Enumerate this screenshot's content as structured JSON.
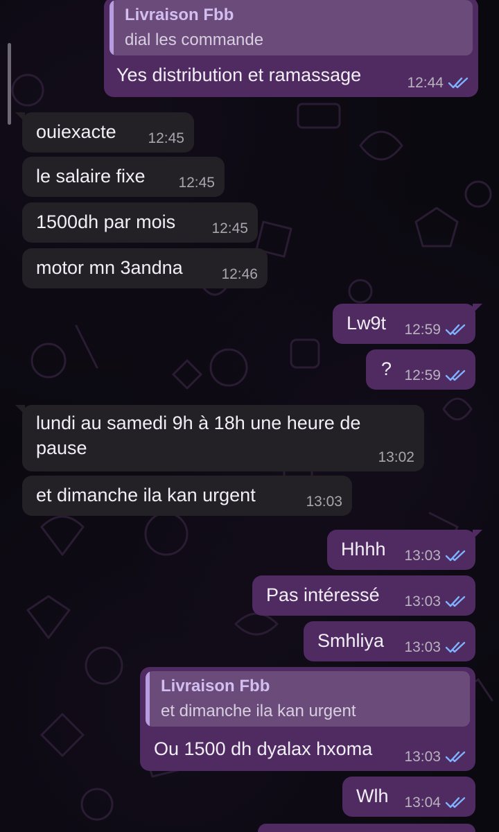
{
  "chat": {
    "messages": [
      {
        "id": "m1",
        "direction": "out",
        "quote": {
          "sender": "Livraison Fbb",
          "text": "dial les commande"
        },
        "text": "Yes distribution et ramassage",
        "time": "12:44",
        "status": "read"
      },
      {
        "id": "m2",
        "direction": "in",
        "text": "ouiexacte",
        "time": "12:45"
      },
      {
        "id": "m3",
        "direction": "in",
        "text": "le salaire fixe",
        "time": "12:45"
      },
      {
        "id": "m4",
        "direction": "in",
        "text": "1500dh par mois",
        "time": "12:45"
      },
      {
        "id": "m5",
        "direction": "in",
        "text": "motor mn 3andna",
        "time": "12:46"
      },
      {
        "id": "m6",
        "direction": "out",
        "text": "Lw9t",
        "time": "12:59",
        "status": "read"
      },
      {
        "id": "m7",
        "direction": "out",
        "text": "?",
        "time": "12:59",
        "status": "read"
      },
      {
        "id": "m8",
        "direction": "in",
        "text": "lundi au samedi 9h à 18h une heure de pause",
        "time": "13:02"
      },
      {
        "id": "m9",
        "direction": "in",
        "text": "et dimanche  ila kan urgent",
        "time": "13:03"
      },
      {
        "id": "m10",
        "direction": "out",
        "text": "Hhhh",
        "time": "13:03",
        "status": "read"
      },
      {
        "id": "m11",
        "direction": "out",
        "text": "Pas intéressé",
        "time": "13:03",
        "status": "read"
      },
      {
        "id": "m12",
        "direction": "out",
        "text": "Smhliya",
        "time": "13:03",
        "status": "read"
      },
      {
        "id": "m13",
        "direction": "out",
        "quote": {
          "sender": "Livraison Fbb",
          "text": "et dimanche  ila kan urgent"
        },
        "text": "Ou 1500 dh dyalax hxoma",
        "time": "13:03",
        "status": "read"
      },
      {
        "id": "m14",
        "direction": "out",
        "text": "Wlh",
        "time": "13:04",
        "status": "read"
      }
    ]
  },
  "colors": {
    "background": "#0b0910",
    "incoming_bubble": "#232125",
    "outgoing_bubble": "#4f2b61",
    "quote_bubble": "#6a4b7a",
    "quote_accent": "#b89ce0",
    "read_ticks": "#7fb2ff"
  },
  "icons": {
    "read_receipt": "double-check-icon",
    "wallpaper": "doodle-pattern"
  }
}
